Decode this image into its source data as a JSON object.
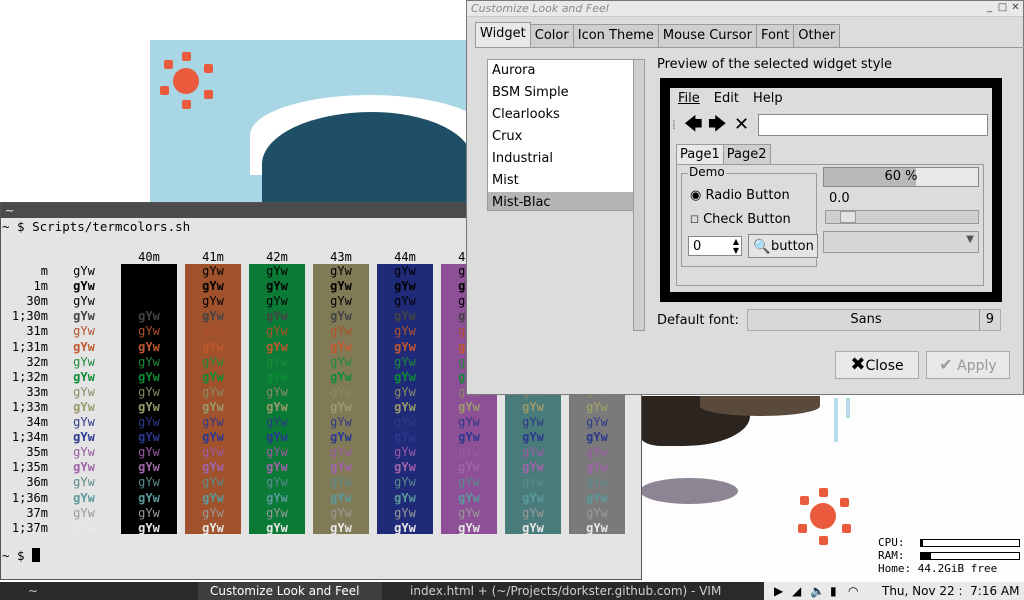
{
  "terminal": {
    "title": "~",
    "command_line": "~ $ Scripts/termcolors.sh",
    "final_prompt": "~ $ ",
    "fg_sample": "gYw",
    "bg_columns": [
      {
        "label": "40m",
        "color": "#000000"
      },
      {
        "label": "41m",
        "color": "#a0522d"
      },
      {
        "label": "42m",
        "color": "#0b7a37"
      },
      {
        "label": "43m",
        "color": "#817a57"
      },
      {
        "label": "44m",
        "color": "#1f2a78"
      },
      {
        "label": "45m",
        "color": "#8d4f96"
      },
      {
        "label": "46m",
        "color": "#4a7b7b"
      },
      {
        "label": "47m",
        "color": "#7a7a7a"
      }
    ],
    "rows": [
      {
        "label": "m",
        "color": "#000000",
        "bold": false
      },
      {
        "label": "1m",
        "color": "#000000",
        "bold": true
      },
      {
        "label": "30m",
        "color": "#000000",
        "bold": false
      },
      {
        "label": "1;30m",
        "color": "#444444",
        "bold": true
      },
      {
        "label": "31m",
        "color": "#b0502a",
        "bold": false
      },
      {
        "label": "1;31m",
        "color": "#c0582e",
        "bold": true
      },
      {
        "label": "32m",
        "color": "#1e8a3a",
        "bold": false
      },
      {
        "label": "1;32m",
        "color": "#0e8c34",
        "bold": true
      },
      {
        "label": "33m",
        "color": "#8a8a64",
        "bold": false
      },
      {
        "label": "1;33m",
        "color": "#9a9a6a",
        "bold": true
      },
      {
        "label": "34m",
        "color": "#2d3a88",
        "bold": false
      },
      {
        "label": "1;34m",
        "color": "#2a3890",
        "bold": true
      },
      {
        "label": "35m",
        "color": "#9a5aa4",
        "bold": false
      },
      {
        "label": "1;35m",
        "color": "#a064aa",
        "bold": true
      },
      {
        "label": "36m",
        "color": "#5a8c8c",
        "bold": false
      },
      {
        "label": "1;36m",
        "color": "#5a9a9a",
        "bold": true
      },
      {
        "label": "37m",
        "color": "#9a9a9a",
        "bold": false
      },
      {
        "label": "1;37m",
        "color": "#e8e8e8",
        "bold": true
      }
    ]
  },
  "dialog": {
    "title": "Customize Look and Feel",
    "tabs": [
      "Widget",
      "Color",
      "Icon Theme",
      "Mouse Cursor",
      "Font",
      "Other"
    ],
    "active_tab": "Widget",
    "themes": [
      "Aurora",
      "BSM Simple",
      "Clearlooks",
      "Crux",
      "Industrial",
      "Mist",
      "Mist-Blac"
    ],
    "selected_theme": "Mist-Blac",
    "preview_label": "Preview of the selected widget style",
    "preview": {
      "menu": [
        "File",
        "Edit",
        "Help"
      ],
      "pages": [
        "Page1",
        "Page2"
      ],
      "demo_label": "Demo",
      "radio_label": "Radio Button",
      "check_label": "Check Button",
      "spin_value": "0",
      "button_label": "button",
      "progress_text": "60 %",
      "progress_value": 0.6,
      "scale_value": "0.0"
    },
    "default_font_label": "Default font:",
    "font_name": "Sans",
    "font_size": "9",
    "close_label": "Close",
    "apply_label": "Apply"
  },
  "sysmon": {
    "cpu_label": "CPU:",
    "ram_label": "RAM:",
    "home": "Home: 44.2GiB free",
    "cpu_usage": 0.02,
    "ram_usage": 0.1
  },
  "taskbar": {
    "items": [
      "~",
      "Customize Look and Feel",
      "index.html + (~/Projects/dorkster.github.com) - VIM"
    ],
    "clock": "Thu, Nov 22 :  7:16 AM"
  }
}
